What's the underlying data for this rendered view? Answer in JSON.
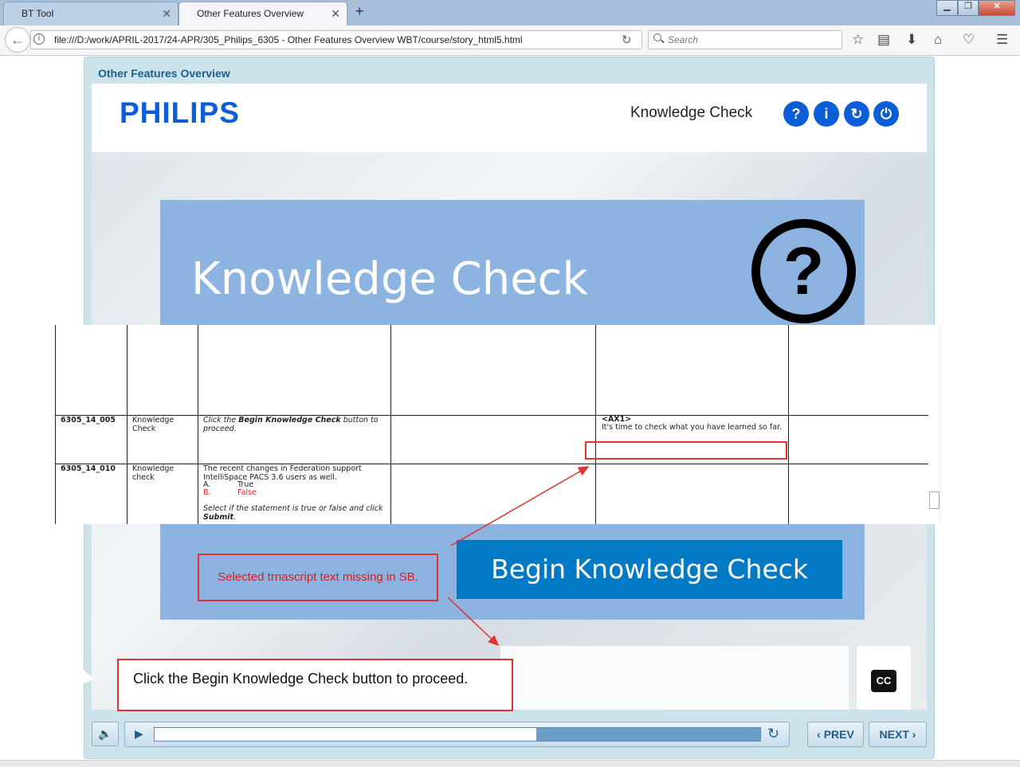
{
  "browser": {
    "tabs": [
      {
        "label": "BT Tool",
        "active": false
      },
      {
        "label": "Other Features Overview",
        "active": true
      }
    ],
    "new_tab_symbol": "+",
    "close_symbol": "✕",
    "url": "file:///D:/work/APRIL-2017/24-APR/305_Philips_6305 - Other Features Overview WBT/course/story_html5.html",
    "search_placeholder": "Search",
    "window_controls": [
      "minimize",
      "restore",
      "close"
    ],
    "toolbar_icons": [
      "bookmark-star-icon",
      "reading-list-icon",
      "download-icon",
      "home-icon",
      "pocket-icon",
      "menu-icon"
    ]
  },
  "course": {
    "title": "Other Features Overview",
    "logo": "PHILIPS",
    "header_label": "Knowledge Check",
    "header_buttons": [
      {
        "name": "help",
        "glyph": "?"
      },
      {
        "name": "info",
        "glyph": "i"
      },
      {
        "name": "replay",
        "glyph": "↻"
      },
      {
        "name": "exit",
        "glyph": "⏻"
      }
    ],
    "slide_heading": "Knowledge Check",
    "question_glyph": "?",
    "begin_button": "Begin Knowledge Check",
    "annotation_note": "Selected trnascript text missing in SB.",
    "caption": "Click the Begin Knowledge Check button to proceed.",
    "cc_label": "CC",
    "prev_label": "PREV",
    "next_label": "NEXT",
    "progress": 0.63
  },
  "storyboard_table": {
    "rows": [
      {
        "id": "6305_14_005",
        "screen": "Knowledge Check",
        "onscreen_pre": "Click the ",
        "onscreen_bold": "Begin Knowledge Check",
        "onscreen_post": " button to proceed.",
        "audio_tag": "<AX1>",
        "audio_text": "It's time to check what you have learned so far."
      },
      {
        "id": "6305_14_010",
        "screen": "Knowledge check",
        "question": "The recent changes in Federation support IntelliSpace PACS 3.6 users as well.",
        "option_a_letter": "A.",
        "option_a": "True",
        "option_b_letter": "B.",
        "option_b": "False",
        "instruction_pre": "Select if the statement is true or false and click ",
        "instruction_bold": "Submit",
        "instruction_post": "."
      }
    ]
  },
  "colors": {
    "philips_blue": "#0b5ed7",
    "panel_blue": "#8db3e0",
    "button_blue": "#0279c4",
    "annotation_red": "#e0322f"
  }
}
